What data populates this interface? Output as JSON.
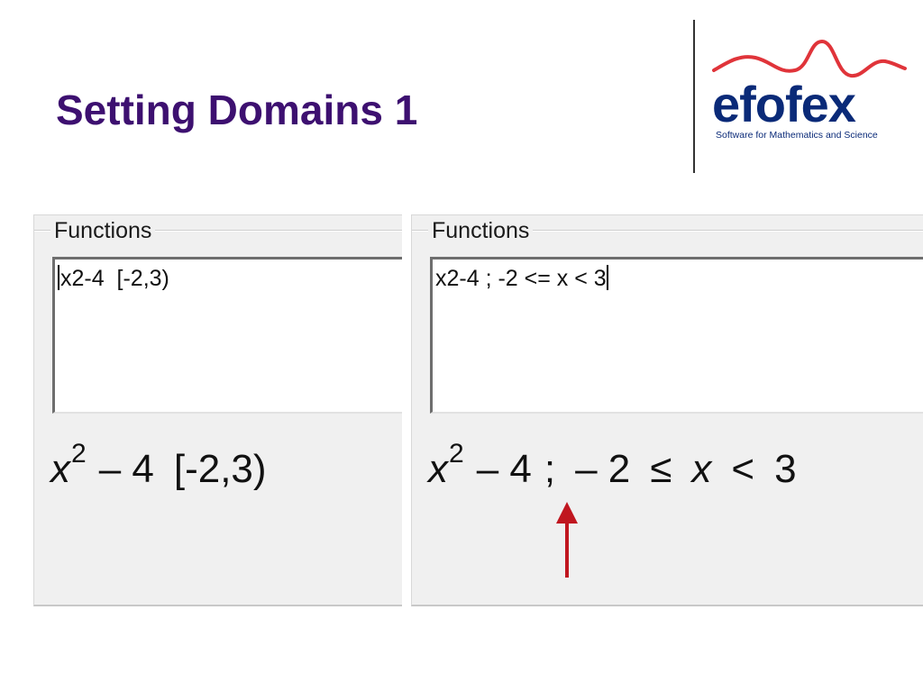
{
  "slide": {
    "title": "Setting Domains 1"
  },
  "logo": {
    "wordmark": "efofex",
    "tagline": "Software for Mathematics and Science",
    "colors": {
      "wave": "#e0343a",
      "text": "#0a2a78"
    }
  },
  "panels": [
    {
      "group_label": "Functions",
      "input_value": "x2-4  [-2,3)",
      "rendered": {
        "base": "x",
        "exponent": "2",
        "rest": "– 4",
        "domain": "[-2,3)"
      }
    },
    {
      "group_label": "Functions",
      "input_value": "x2-4 ; -2 <= x < 3",
      "rendered": {
        "base": "x",
        "exponent": "2",
        "rest": "– 4",
        "semicolon": ";",
        "lower": "– 2",
        "op1": "≤",
        "var": "x",
        "op2": "<",
        "upper": "3"
      }
    }
  ],
  "colors": {
    "title": "#3d1070",
    "arrow": "#c0161f",
    "panel_bg": "#f0f0f0"
  },
  "icons": [
    "up-arrow-icon"
  ]
}
